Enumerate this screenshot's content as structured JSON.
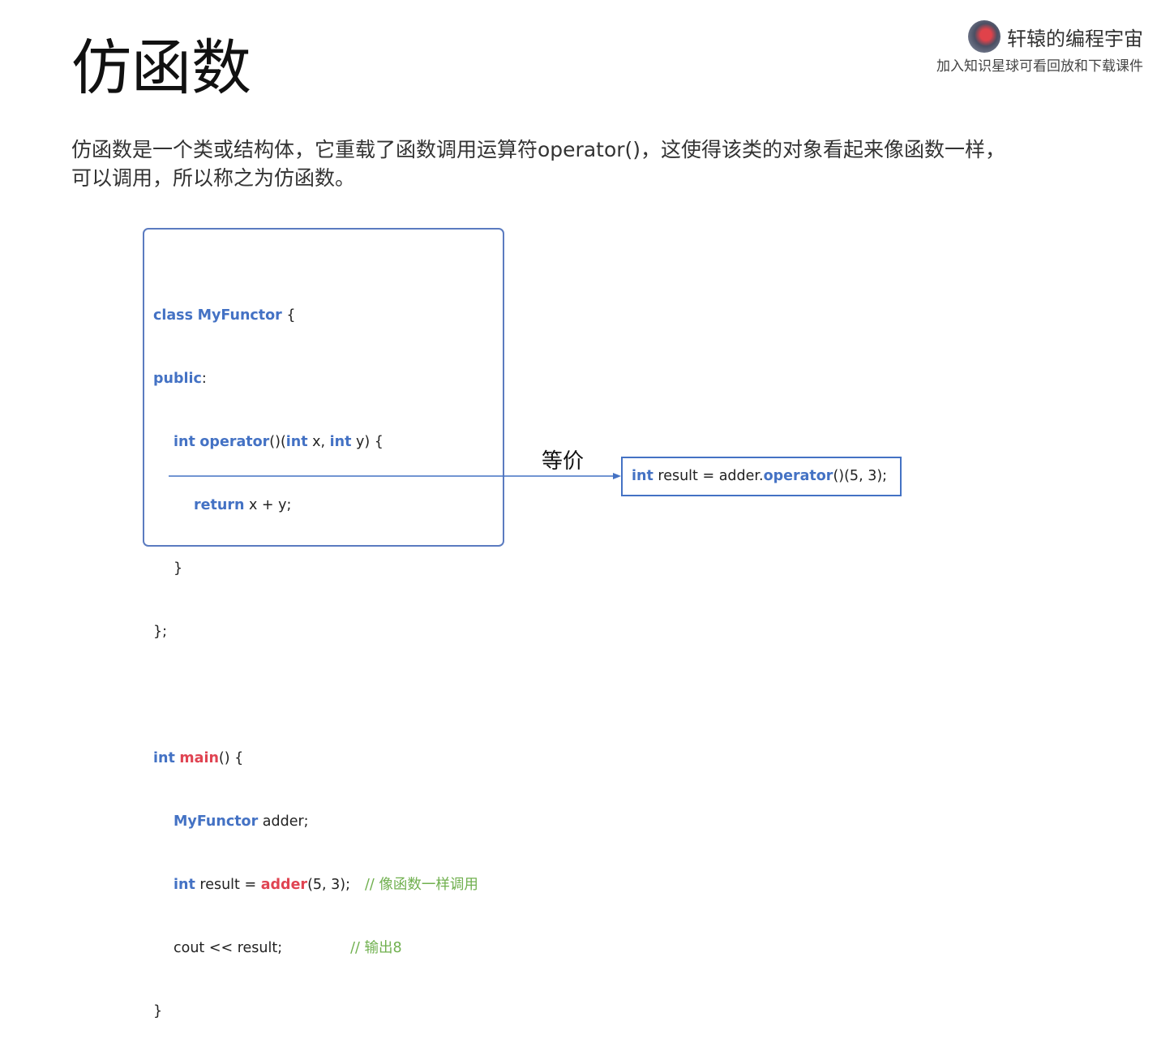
{
  "title": "仿函数",
  "brand": {
    "name": "轩辕的编程宇宙",
    "subtitle": "加入知识星球可看回放和下载课件"
  },
  "intro": {
    "line1": "仿函数是一个类或结构体，它重载了函数调用运算符operator()，这使得该类的对象看起来像函数一样，",
    "line2": "可以调用，所以称之为仿函数。"
  },
  "code": {
    "l1_kw": "class",
    "l1_name": "MyFunctor",
    "l1_rest": " {",
    "l2_kw": "public",
    "l2_rest": ":",
    "l3_kw1": "int",
    "l3_op": "operator",
    "l3_p1": "()(",
    "l3_kw2": "int",
    "l3_p2": " x, ",
    "l3_kw3": "int",
    "l3_p3": " y) {",
    "l4_kw": "return",
    "l4_rest": " x + y;",
    "l5": "}",
    "l6": "};",
    "l8_kw": "int",
    "l8_fn": "main",
    "l8_rest": "() {",
    "l9_type": "MyFunctor",
    "l9_rest": " adder;",
    "l10_kw": "int",
    "l10_a": " result = ",
    "l10_fn": "adder",
    "l10_b": "(5, 3);",
    "l10_comment": "// 像函数一样调用",
    "l11_a": "cout << result;",
    "l11_comment": "// 输出8",
    "l12": "}"
  },
  "equiv_label": "等价",
  "equiv_code": {
    "kw": "int",
    "a": " result = adder.",
    "op": "operator",
    "b": "()(5, 3);"
  },
  "colors": {
    "keyword": "#4472c4",
    "function": "#e04452",
    "comment": "#70b04f",
    "box_border": "#5b7bc0"
  }
}
